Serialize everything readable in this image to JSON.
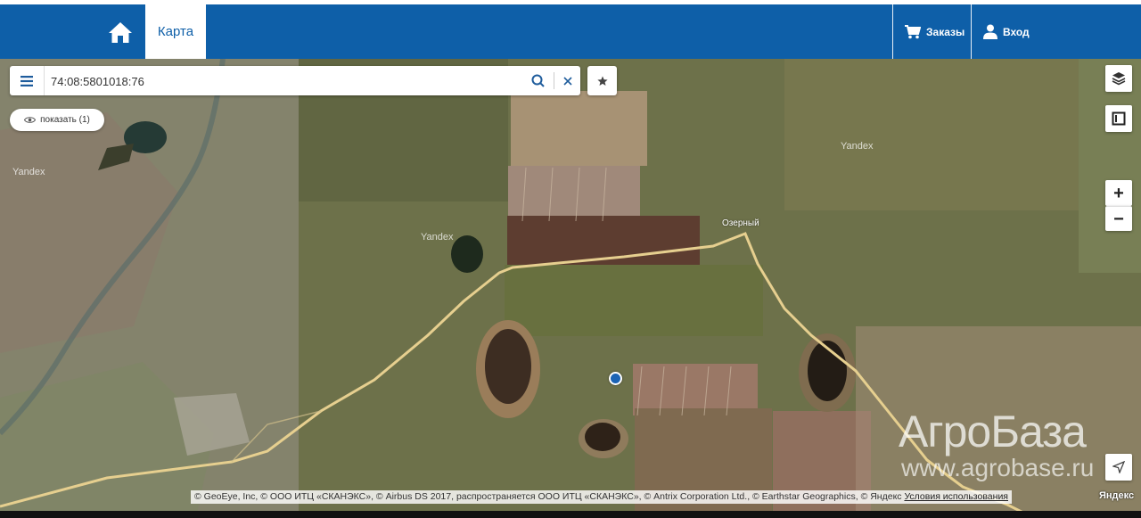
{
  "header": {
    "nav_tab_label": "Карта",
    "orders_label": "Заказы",
    "login_label": "Вход",
    "bg_color": "#0e5fa8"
  },
  "search": {
    "value": "74:08:5801018:76",
    "placeholder": ""
  },
  "show_button": {
    "label": "показать (1)"
  },
  "map": {
    "place_label": "Озерный",
    "yandex_watermarks": [
      "Yandex",
      "Yandex",
      "Yandex"
    ],
    "icons": [
      "home-icon",
      "cart-icon",
      "user-icon",
      "menu-icon",
      "search-icon",
      "close-icon",
      "star-icon",
      "eye-icon",
      "layers-icon",
      "frame-icon",
      "plus-icon",
      "minus-icon",
      "navigate-arrow-icon"
    ],
    "zoom_in": "+",
    "zoom_out": "−"
  },
  "watermark": {
    "brand": "АгроБаза",
    "url": "www.agrobase.ru"
  },
  "copyright": {
    "text": "© GeoEye, Inc, © ООО ИТЦ «СКАНЭКС», © Airbus DS 2017, распространяется ООО ИТЦ «СКАНЭКС», © Antrix Corporation Ltd., © Earthstar Geographics, © Яндекс ",
    "terms_link": "Условия использования",
    "logo": "Яндекс"
  }
}
